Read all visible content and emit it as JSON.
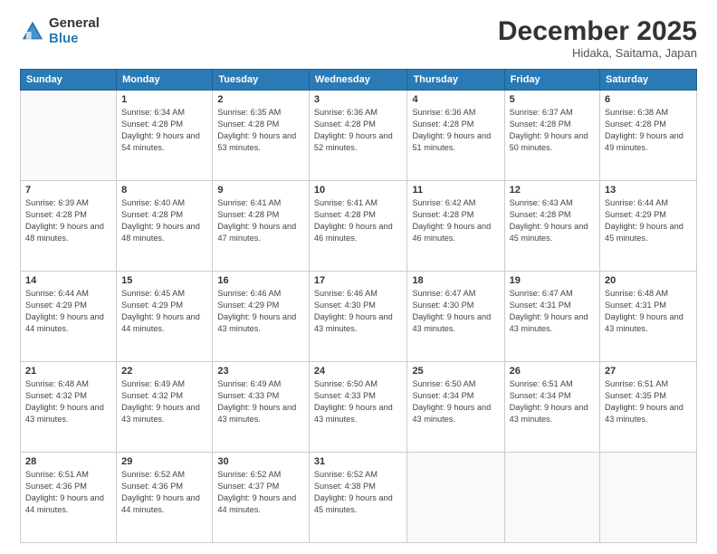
{
  "logo": {
    "general": "General",
    "blue": "Blue"
  },
  "header": {
    "month": "December 2025",
    "location": "Hidaka, Saitama, Japan"
  },
  "days_of_week": [
    "Sunday",
    "Monday",
    "Tuesday",
    "Wednesday",
    "Thursday",
    "Friday",
    "Saturday"
  ],
  "weeks": [
    [
      {
        "day": "",
        "sunrise": "",
        "sunset": "",
        "daylight": "",
        "empty": true
      },
      {
        "day": "1",
        "sunrise": "Sunrise: 6:34 AM",
        "sunset": "Sunset: 4:28 PM",
        "daylight": "Daylight: 9 hours and 54 minutes."
      },
      {
        "day": "2",
        "sunrise": "Sunrise: 6:35 AM",
        "sunset": "Sunset: 4:28 PM",
        "daylight": "Daylight: 9 hours and 53 minutes."
      },
      {
        "day": "3",
        "sunrise": "Sunrise: 6:36 AM",
        "sunset": "Sunset: 4:28 PM",
        "daylight": "Daylight: 9 hours and 52 minutes."
      },
      {
        "day": "4",
        "sunrise": "Sunrise: 6:36 AM",
        "sunset": "Sunset: 4:28 PM",
        "daylight": "Daylight: 9 hours and 51 minutes."
      },
      {
        "day": "5",
        "sunrise": "Sunrise: 6:37 AM",
        "sunset": "Sunset: 4:28 PM",
        "daylight": "Daylight: 9 hours and 50 minutes."
      },
      {
        "day": "6",
        "sunrise": "Sunrise: 6:38 AM",
        "sunset": "Sunset: 4:28 PM",
        "daylight": "Daylight: 9 hours and 49 minutes."
      }
    ],
    [
      {
        "day": "7",
        "sunrise": "Sunrise: 6:39 AM",
        "sunset": "Sunset: 4:28 PM",
        "daylight": "Daylight: 9 hours and 48 minutes."
      },
      {
        "day": "8",
        "sunrise": "Sunrise: 6:40 AM",
        "sunset": "Sunset: 4:28 PM",
        "daylight": "Daylight: 9 hours and 48 minutes."
      },
      {
        "day": "9",
        "sunrise": "Sunrise: 6:41 AM",
        "sunset": "Sunset: 4:28 PM",
        "daylight": "Daylight: 9 hours and 47 minutes."
      },
      {
        "day": "10",
        "sunrise": "Sunrise: 6:41 AM",
        "sunset": "Sunset: 4:28 PM",
        "daylight": "Daylight: 9 hours and 46 minutes."
      },
      {
        "day": "11",
        "sunrise": "Sunrise: 6:42 AM",
        "sunset": "Sunset: 4:28 PM",
        "daylight": "Daylight: 9 hours and 46 minutes."
      },
      {
        "day": "12",
        "sunrise": "Sunrise: 6:43 AM",
        "sunset": "Sunset: 4:28 PM",
        "daylight": "Daylight: 9 hours and 45 minutes."
      },
      {
        "day": "13",
        "sunrise": "Sunrise: 6:44 AM",
        "sunset": "Sunset: 4:29 PM",
        "daylight": "Daylight: 9 hours and 45 minutes."
      }
    ],
    [
      {
        "day": "14",
        "sunrise": "Sunrise: 6:44 AM",
        "sunset": "Sunset: 4:29 PM",
        "daylight": "Daylight: 9 hours and 44 minutes."
      },
      {
        "day": "15",
        "sunrise": "Sunrise: 6:45 AM",
        "sunset": "Sunset: 4:29 PM",
        "daylight": "Daylight: 9 hours and 44 minutes."
      },
      {
        "day": "16",
        "sunrise": "Sunrise: 6:46 AM",
        "sunset": "Sunset: 4:29 PM",
        "daylight": "Daylight: 9 hours and 43 minutes."
      },
      {
        "day": "17",
        "sunrise": "Sunrise: 6:46 AM",
        "sunset": "Sunset: 4:30 PM",
        "daylight": "Daylight: 9 hours and 43 minutes."
      },
      {
        "day": "18",
        "sunrise": "Sunrise: 6:47 AM",
        "sunset": "Sunset: 4:30 PM",
        "daylight": "Daylight: 9 hours and 43 minutes."
      },
      {
        "day": "19",
        "sunrise": "Sunrise: 6:47 AM",
        "sunset": "Sunset: 4:31 PM",
        "daylight": "Daylight: 9 hours and 43 minutes."
      },
      {
        "day": "20",
        "sunrise": "Sunrise: 6:48 AM",
        "sunset": "Sunset: 4:31 PM",
        "daylight": "Daylight: 9 hours and 43 minutes."
      }
    ],
    [
      {
        "day": "21",
        "sunrise": "Sunrise: 6:48 AM",
        "sunset": "Sunset: 4:32 PM",
        "daylight": "Daylight: 9 hours and 43 minutes."
      },
      {
        "day": "22",
        "sunrise": "Sunrise: 6:49 AM",
        "sunset": "Sunset: 4:32 PM",
        "daylight": "Daylight: 9 hours and 43 minutes."
      },
      {
        "day": "23",
        "sunrise": "Sunrise: 6:49 AM",
        "sunset": "Sunset: 4:33 PM",
        "daylight": "Daylight: 9 hours and 43 minutes."
      },
      {
        "day": "24",
        "sunrise": "Sunrise: 6:50 AM",
        "sunset": "Sunset: 4:33 PM",
        "daylight": "Daylight: 9 hours and 43 minutes."
      },
      {
        "day": "25",
        "sunrise": "Sunrise: 6:50 AM",
        "sunset": "Sunset: 4:34 PM",
        "daylight": "Daylight: 9 hours and 43 minutes."
      },
      {
        "day": "26",
        "sunrise": "Sunrise: 6:51 AM",
        "sunset": "Sunset: 4:34 PM",
        "daylight": "Daylight: 9 hours and 43 minutes."
      },
      {
        "day": "27",
        "sunrise": "Sunrise: 6:51 AM",
        "sunset": "Sunset: 4:35 PM",
        "daylight": "Daylight: 9 hours and 43 minutes."
      }
    ],
    [
      {
        "day": "28",
        "sunrise": "Sunrise: 6:51 AM",
        "sunset": "Sunset: 4:36 PM",
        "daylight": "Daylight: 9 hours and 44 minutes."
      },
      {
        "day": "29",
        "sunrise": "Sunrise: 6:52 AM",
        "sunset": "Sunset: 4:36 PM",
        "daylight": "Daylight: 9 hours and 44 minutes."
      },
      {
        "day": "30",
        "sunrise": "Sunrise: 6:52 AM",
        "sunset": "Sunset: 4:37 PM",
        "daylight": "Daylight: 9 hours and 44 minutes."
      },
      {
        "day": "31",
        "sunrise": "Sunrise: 6:52 AM",
        "sunset": "Sunset: 4:38 PM",
        "daylight": "Daylight: 9 hours and 45 minutes."
      },
      {
        "day": "",
        "sunrise": "",
        "sunset": "",
        "daylight": "",
        "empty": true
      },
      {
        "day": "",
        "sunrise": "",
        "sunset": "",
        "daylight": "",
        "empty": true
      },
      {
        "day": "",
        "sunrise": "",
        "sunset": "",
        "daylight": "",
        "empty": true
      }
    ]
  ]
}
